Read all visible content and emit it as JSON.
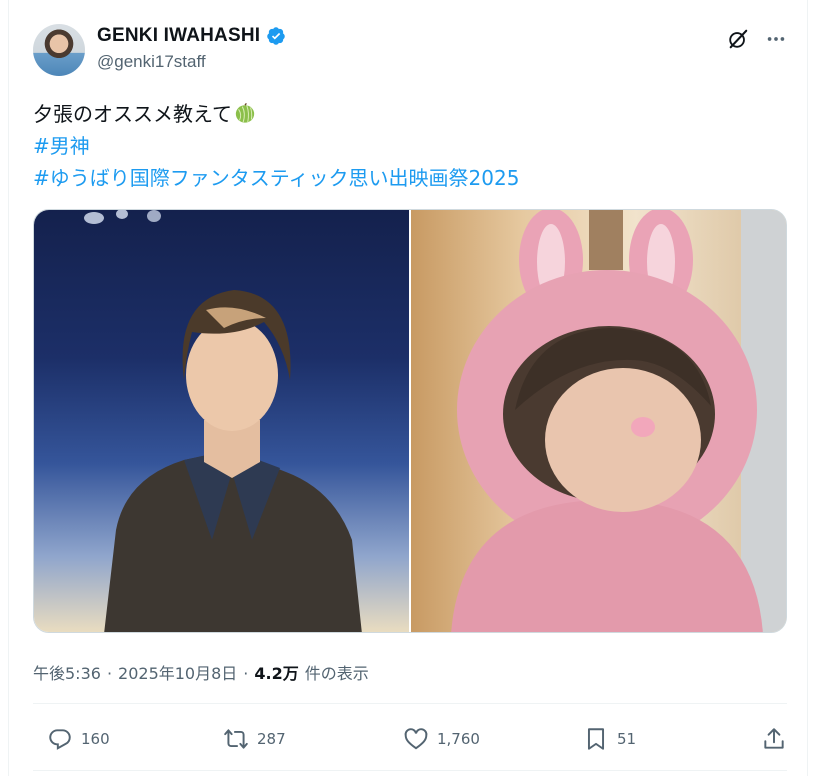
{
  "author": {
    "display_name": "GENKI IWAHASHI",
    "handle": "@genki17staff",
    "verified": true
  },
  "tweet": {
    "text_line1": "夕張のオススメ教えて",
    "emoji": "melon",
    "hashtag1": "#男神",
    "hashtag2": "#ゆうばり国際ファンタスティック思い出映画祭2025"
  },
  "meta": {
    "time": "午後5:36",
    "separator1": "·",
    "date": "2025年10月8日",
    "separator2": "·",
    "views": "4.2万",
    "views_label": "件の表示"
  },
  "actions": {
    "replies": "160",
    "retweets": "287",
    "likes": "1,760",
    "bookmarks": "51"
  },
  "colors": {
    "accent": "#1d9bf0",
    "text": "#0f1419",
    "secondary": "#536471"
  },
  "icons": [
    "verified-badge-icon",
    "grok-icon",
    "more-icon",
    "reply-icon",
    "retweet-icon",
    "like-icon",
    "bookmark-icon",
    "share-icon"
  ]
}
